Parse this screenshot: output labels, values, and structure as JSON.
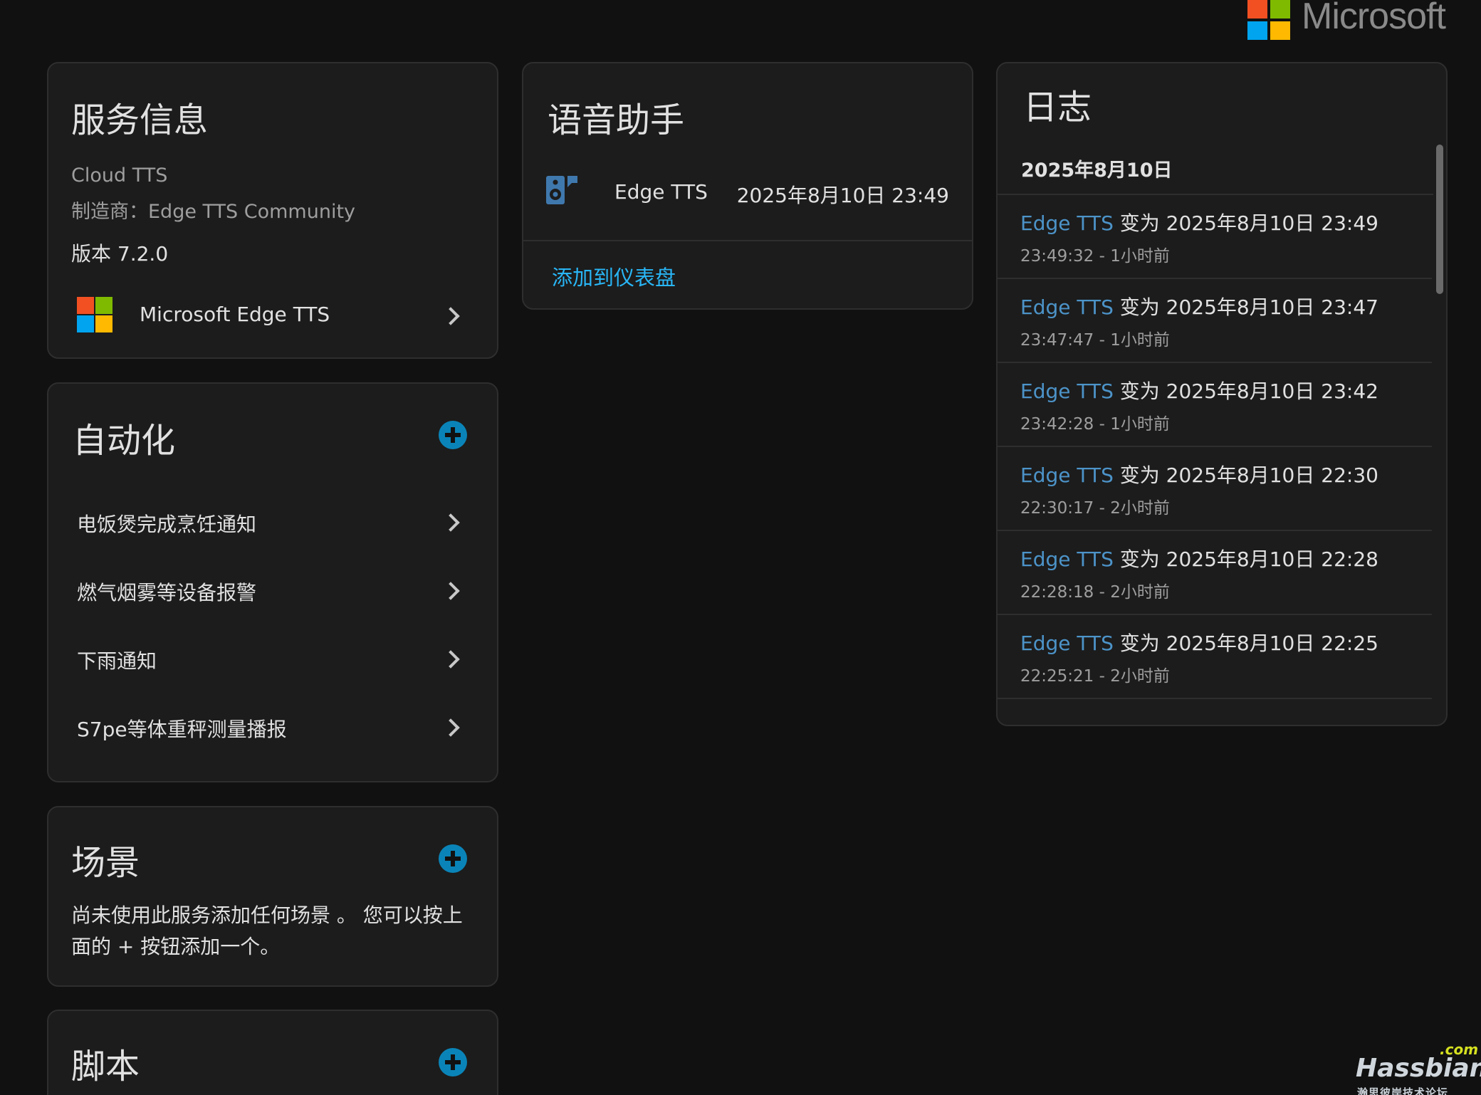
{
  "brand": {
    "name": "Microsoft",
    "logo_colors": [
      "#f25022",
      "#7fba00",
      "#00a4ef",
      "#ffb900"
    ]
  },
  "service_info": {
    "title": "服务信息",
    "name": "Cloud TTS",
    "manufacturer": "制造商：Edge TTS Community",
    "version": "版本 7.2.0",
    "integration": "Microsoft Edge TTS"
  },
  "automation": {
    "title": "自动化",
    "items": [
      {
        "label": "电饭煲完成烹饪通知"
      },
      {
        "label": "燃气烟雾等设备报警"
      },
      {
        "label": "下雨通知"
      },
      {
        "label": "S7pe等体重秤测量播报"
      }
    ]
  },
  "scene": {
    "title": "场景",
    "empty_text": "尚未使用此服务添加任何场景 。 您可以按上面的 + 按钮添加一个。"
  },
  "script": {
    "title": "脚本"
  },
  "voice_assistant": {
    "title": "语音助手",
    "entity_icon": "speaker-icon",
    "entity_name": "Edge TTS",
    "entity_state": "2025年8月10日 23:49",
    "add_to_dashboard": "添加到仪表盘"
  },
  "logbook": {
    "title": "日志",
    "date_header": "2025年8月10日",
    "entries": [
      {
        "entity": "Edge TTS",
        "text": " 变为 2025年8月10日 23:49",
        "time": "23:49:32 - 1小时前"
      },
      {
        "entity": "Edge TTS",
        "text": " 变为 2025年8月10日 23:47",
        "time": "23:47:47 - 1小时前"
      },
      {
        "entity": "Edge TTS",
        "text": " 变为 2025年8月10日 23:42",
        "time": "23:42:28 - 1小时前"
      },
      {
        "entity": "Edge TTS",
        "text": " 变为 2025年8月10日 22:30",
        "time": "22:30:17 - 2小时前"
      },
      {
        "entity": "Edge TTS",
        "text": " 变为 2025年8月10日 22:28",
        "time": "22:28:18 - 2小时前"
      },
      {
        "entity": "Edge TTS",
        "text": " 变为 2025年8月10日 22:25",
        "time": "22:25:21 - 2小时前"
      }
    ]
  },
  "watermark": {
    "com": ".com",
    "main": "Hassbian",
    "sub": "瀚思彼岸技术论坛"
  },
  "colors": {
    "accent": "#0a84b8",
    "link": "#29b6f6",
    "entity": "#4c93c8",
    "card_bg": "#1c1c1c",
    "page_bg": "#111111"
  }
}
